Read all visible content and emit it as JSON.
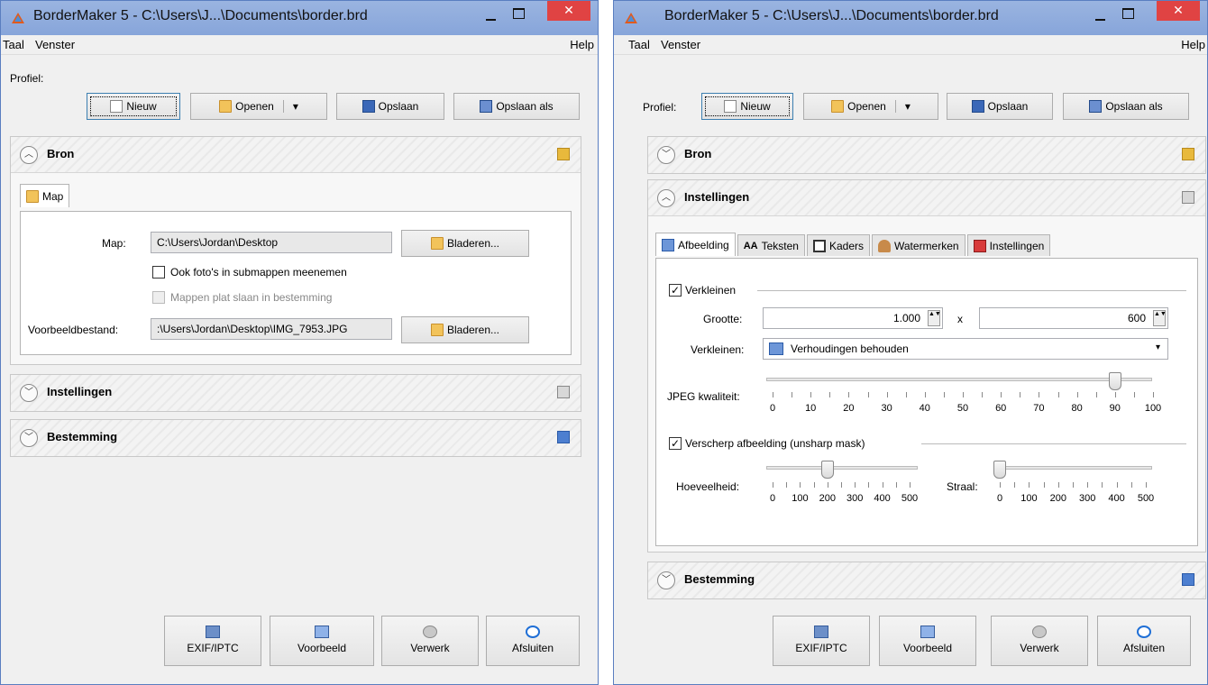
{
  "left": {
    "title": "BorderMaker 5 - C:\\Users\\J...\\Documents\\border.brd",
    "close_glyph": "✕",
    "menu": {
      "taal": "Taal",
      "venster": "Venster",
      "help": "Help"
    },
    "profile": {
      "label": "Profiel:",
      "nieuw": "Nieuw",
      "openen": "Openen",
      "opslaan": "Opslaan",
      "opslaan_als": "Opslaan als"
    },
    "bron": {
      "title": "Bron",
      "tab": "Map",
      "map_label": "Map:",
      "map_value": "C:\\Users\\Jordan\\Desktop",
      "browse1": "Bladeren...",
      "sub_label": "Ook foto's in submappen meenemen",
      "sub_checked": false,
      "flat_label": "Mappen plat slaan in bestemming",
      "flat_enabled": false,
      "preview_label": "Voorbeeldbestand:",
      "preview_value": ":\\Users\\Jordan\\Desktop\\IMG_7953.JPG",
      "browse2": "Bladeren..."
    },
    "instellingen": {
      "title": "Instellingen"
    },
    "bestemming": {
      "title": "Bestemming"
    },
    "bottom": {
      "exif": "EXIF/IPTC",
      "voorbeeld": "Voorbeeld",
      "verwerk": "Verwerk",
      "afsluiten": "Afsluiten"
    }
  },
  "right": {
    "title": "BorderMaker 5 - C:\\Users\\J...\\Documents\\border.brd",
    "close_glyph": "✕",
    "menu": {
      "taal": "Taal",
      "venster": "Venster",
      "help": "Help"
    },
    "profile": {
      "label": "Profiel:",
      "nieuw": "Nieuw",
      "openen": "Openen",
      "opslaan": "Opslaan",
      "opslaan_als": "Opslaan als"
    },
    "bron": {
      "title": "Bron"
    },
    "instellingen": {
      "title": "Instellingen",
      "tabs": [
        "Afbeelding",
        "Teksten",
        "Kaders",
        "Watermerken",
        "Instellingen"
      ],
      "tab_aa": "AA",
      "active_tab": "Afbeelding",
      "verkleinen_label": "Verkleinen",
      "verkleinen_checked": true,
      "grootte_label": "Grootte:",
      "width": "1.000",
      "x": "x",
      "height": "600",
      "mode_label": "Verkleinen:",
      "mode_value": "Verhoudingen behouden",
      "jpeg_label": "JPEG kwaliteit:",
      "jpeg_value": 90,
      "jpeg_ticks": [
        "0",
        "10",
        "20",
        "30",
        "40",
        "50",
        "60",
        "70",
        "80",
        "90",
        "100"
      ],
      "sharpen_label": "Verscherp afbeelding (unsharp mask)",
      "sharpen_checked": true,
      "amount_label": "Hoeveelheid:",
      "amount_value": 200,
      "amount_ticks": [
        "0",
        "100",
        "200",
        "300",
        "400",
        "500"
      ],
      "radius_label": "Straal:",
      "radius_value": 0,
      "radius_ticks": [
        "0",
        "100",
        "200",
        "300",
        "400",
        "500"
      ]
    },
    "bestemming": {
      "title": "Bestemming"
    },
    "bottom": {
      "exif": "EXIF/IPTC",
      "voorbeeld": "Voorbeeld",
      "verwerk": "Verwerk",
      "afsluiten": "Afsluiten"
    }
  },
  "glyphs": {
    "check": "✓",
    "chevron_up": "︿",
    "chevron_down": "﹀",
    "dropdown": "▾",
    "spin": "▲▼"
  }
}
